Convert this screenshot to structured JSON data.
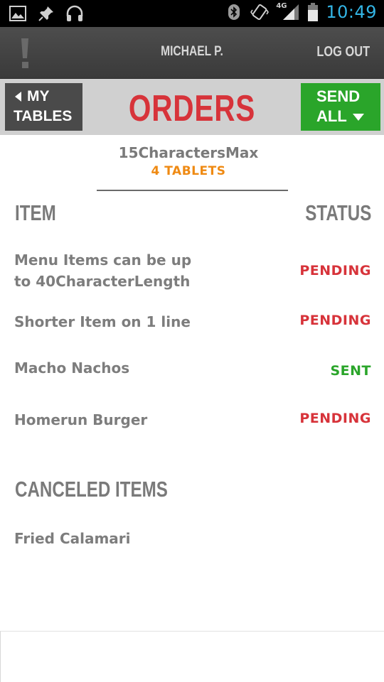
{
  "status_bar": {
    "time": "10:49",
    "network_label": "4G",
    "icons_left": [
      "image-icon",
      "pin-icon",
      "headphones-icon"
    ],
    "icons_right": [
      "bluetooth-icon",
      "vibrate-icon",
      "signal-icon",
      "battery-icon"
    ],
    "time_color": "#33b5e5"
  },
  "app_bar": {
    "user_name": "MICHAEL P.",
    "logout_label": "LOG OUT"
  },
  "header": {
    "back_label_line1": "MY",
    "back_label_line2": "TABLES",
    "title": "ORDERS",
    "send_label_line1": "SEND",
    "send_label_line2": "ALL",
    "title_color": "#d7333a",
    "send_color": "#2aa52a"
  },
  "table": {
    "name": "15CharactersMax",
    "count_label": "4 TABLETS",
    "count_color": "#ef8a13"
  },
  "columns": {
    "item": "ITEM",
    "status": "STATUS"
  },
  "orders": [
    {
      "item_line1": "Menu Items can be up",
      "item_line2": "to 40CharacterLength",
      "status": "PENDING",
      "status_color": "#d7333a"
    },
    {
      "item_line1": "Shorter Item on 1 line",
      "item_line2": "",
      "status": "PENDING",
      "status_color": "#d7333a"
    },
    {
      "item_line1": "Macho Nachos",
      "item_line2": "",
      "status": "SENT",
      "status_color": "#2aa52a"
    },
    {
      "item_line1": "Homerun Burger",
      "item_line2": "",
      "status": "PENDING",
      "status_color": "#d7333a"
    }
  ],
  "canceled": {
    "heading": "CANCELED ITEMS",
    "items": [
      "Fried Calamari"
    ]
  }
}
